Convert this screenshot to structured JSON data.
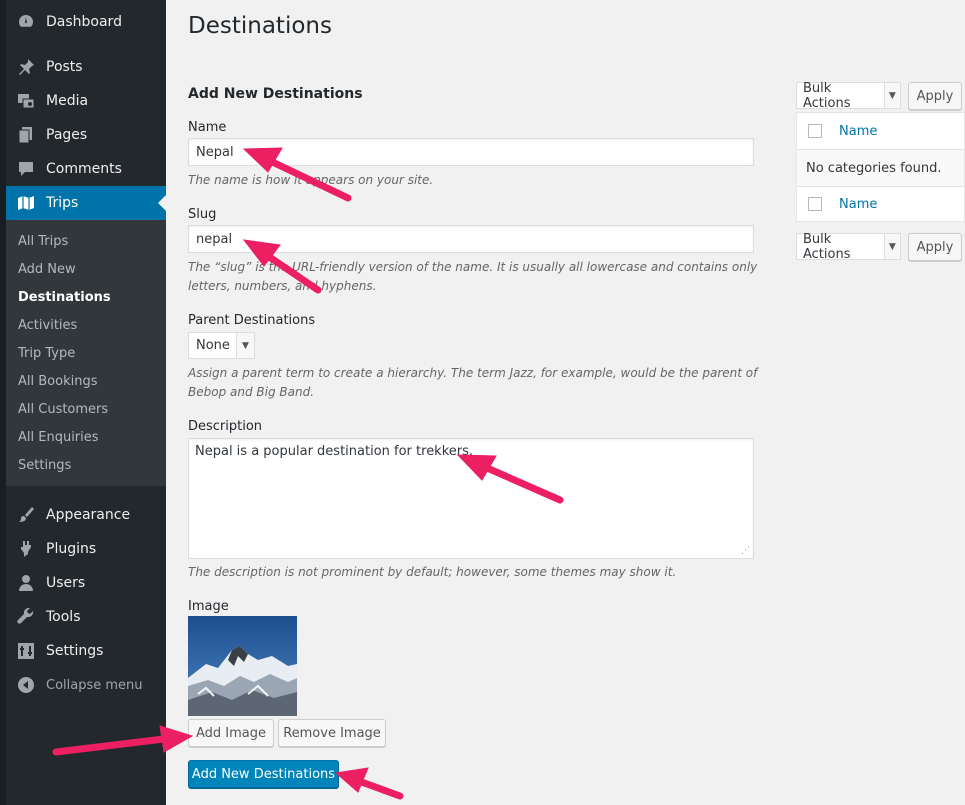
{
  "sidebar": {
    "items": [
      {
        "label": "Dashboard",
        "icon": "dashboard-icon"
      },
      {
        "label": "Posts",
        "icon": "pin-icon"
      },
      {
        "label": "Media",
        "icon": "media-icon"
      },
      {
        "label": "Pages",
        "icon": "pages-icon"
      },
      {
        "label": "Comments",
        "icon": "comment-icon"
      },
      {
        "label": "Trips",
        "icon": "map-icon"
      },
      {
        "label": "Appearance",
        "icon": "brush-icon"
      },
      {
        "label": "Plugins",
        "icon": "plugin-icon"
      },
      {
        "label": "Users",
        "icon": "user-icon"
      },
      {
        "label": "Tools",
        "icon": "wrench-icon"
      },
      {
        "label": "Settings",
        "icon": "settings-icon"
      }
    ],
    "submenu": [
      "All Trips",
      "Add New",
      "Destinations",
      "Activities",
      "Trip Type",
      "All Bookings",
      "All Customers",
      "All Enquiries",
      "Settings"
    ],
    "collapse_label": "Collapse menu",
    "active_color": "#0073aa"
  },
  "page": {
    "title": "Destinations",
    "section_title": "Add New Destinations"
  },
  "form": {
    "name_label": "Name",
    "name_value": "Nepal",
    "name_hint": "The name is how it appears on your site.",
    "slug_label": "Slug",
    "slug_value": "nepal",
    "slug_hint": "The “slug” is the URL-friendly version of the name. It is usually all lowercase and contains only letters, numbers, and hyphens.",
    "parent_label": "Parent Destinations",
    "parent_value": "None",
    "parent_hint": "Assign a parent term to create a hierarchy. The term Jazz, for example, would be the parent of Bebop and Big Band.",
    "description_label": "Description",
    "description_value": "Nepal is a popular destination for trekkers.",
    "description_hint": "The description is not prominent by default; however, some themes may show it.",
    "image_label": "Image",
    "add_image_label": "Add Image",
    "remove_image_label": "Remove Image",
    "submit_label": "Add New Destinations"
  },
  "list": {
    "bulk_actions_label": "Bulk Actions",
    "apply_label": "Apply",
    "column_name": "Name",
    "empty_message": "No categories found."
  }
}
